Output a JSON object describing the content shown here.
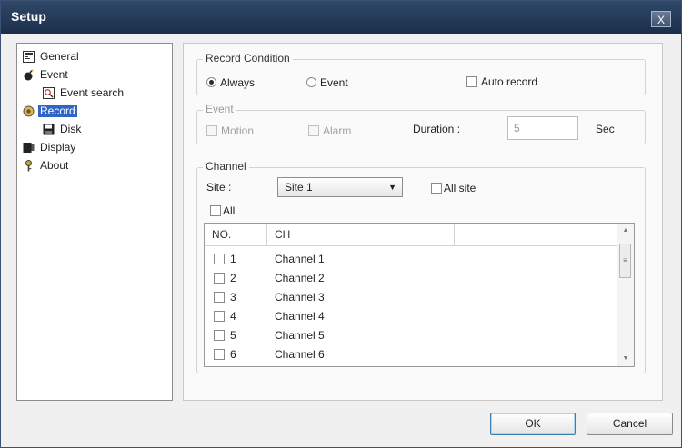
{
  "window": {
    "title": "Setup",
    "close_label": "X"
  },
  "tree": {
    "items": [
      {
        "label": "General"
      },
      {
        "label": "Event"
      },
      {
        "label": "Event search"
      },
      {
        "label": "Record"
      },
      {
        "label": "Disk"
      },
      {
        "label": "Display"
      },
      {
        "label": "About"
      }
    ]
  },
  "record_condition": {
    "legend": "Record Condition",
    "always_label": "Always",
    "event_label": "Event",
    "auto_record_label": "Auto record",
    "selected": "Always"
  },
  "event": {
    "legend": "Event",
    "motion_label": "Motion",
    "alarm_label": "Alarm",
    "duration_label": "Duration :",
    "duration_value": "5",
    "duration_unit": "Sec"
  },
  "channel": {
    "legend": "Channel",
    "site_label": "Site :",
    "site_value": "Site 1",
    "all_site_label": "All site",
    "all_label": "All",
    "columns": [
      "NO.",
      "CH"
    ],
    "rows": [
      {
        "no": "1",
        "ch": "Channel 1"
      },
      {
        "no": "2",
        "ch": "Channel 2"
      },
      {
        "no": "3",
        "ch": "Channel 3"
      },
      {
        "no": "4",
        "ch": "Channel 4"
      },
      {
        "no": "5",
        "ch": "Channel 5"
      },
      {
        "no": "6",
        "ch": "Channel 6"
      }
    ]
  },
  "buttons": {
    "ok": "OK",
    "cancel": "Cancel"
  }
}
